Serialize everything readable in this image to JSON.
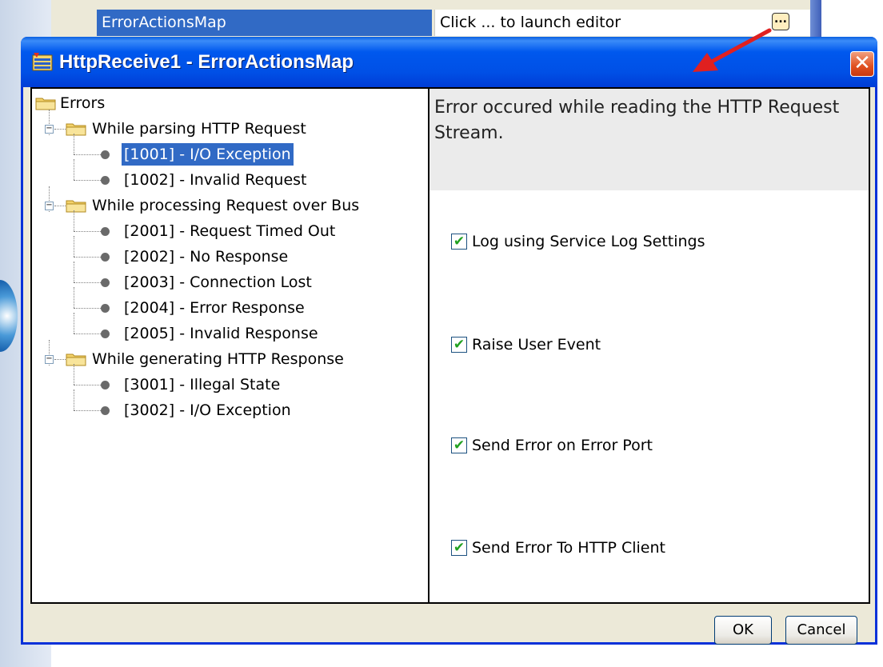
{
  "property_grid": {
    "name": "ErrorActionsMap",
    "value": "Click ... to launch editor",
    "ellipsis_glyph": "..."
  },
  "dialog": {
    "title": "HttpReceive1 - ErrorActionsMap",
    "close_glyph": "✕",
    "tree": {
      "root": "Errors",
      "groups": [
        {
          "label": "While parsing HTTP Request",
          "items": [
            "[1001] - I/O Exception",
            "[1002] - Invalid Request"
          ]
        },
        {
          "label": "While processing Request over Bus",
          "items": [
            "[2001] - Request Timed Out",
            "[2002] - No Response",
            "[2003] - Connection Lost",
            "[2004] - Error Response",
            "[2005] - Invalid Response"
          ]
        },
        {
          "label": "While generating HTTP Response",
          "items": [
            "[3001] - Illegal State",
            "[3002] - I/O Exception"
          ]
        }
      ],
      "selected": "[1001] - I/O Exception"
    },
    "description": "Error occured while reading the HTTP Request Stream.",
    "options": [
      {
        "label": "Log using Service Log Settings",
        "checked": true
      },
      {
        "label": "Raise User Event",
        "checked": true
      },
      {
        "label": "Send Error on Error Port",
        "checked": true
      },
      {
        "label": "Send Error To HTTP Client",
        "checked": true
      }
    ],
    "check_glyph": "✔",
    "ok_label": "OK",
    "cancel_label": "Cancel"
  },
  "colors": {
    "title_bar": "#0054e3",
    "selection": "#316ac5",
    "close_button": "#e05020",
    "annotation_arrow": "#e02020"
  }
}
